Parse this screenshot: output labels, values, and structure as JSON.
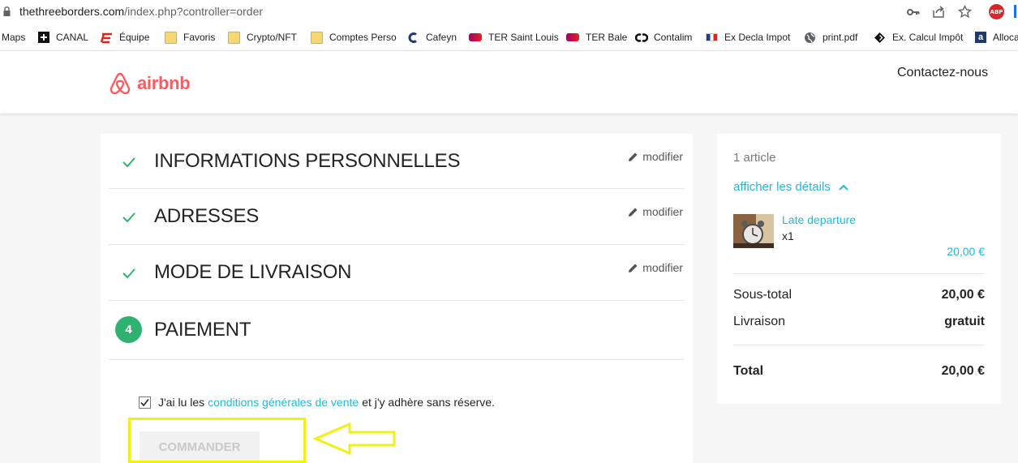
{
  "browser": {
    "url_domain": "thethreeborders.com",
    "url_path": "/index.php?controller=order",
    "abp_label": "ABP"
  },
  "bookmarks": [
    {
      "label": "Maps",
      "icon": "none"
    },
    {
      "label": "CANAL",
      "icon": "canal-plus-icon"
    },
    {
      "label": "Équipe",
      "icon": "lequipe-icon"
    },
    {
      "label": "Favoris",
      "icon": "folder-icon"
    },
    {
      "label": "Crypto/NFT",
      "icon": "folder-icon"
    },
    {
      "label": "Comptes Perso",
      "icon": "folder-icon"
    },
    {
      "label": "Cafeyn",
      "icon": "cafeyn-icon"
    },
    {
      "label": "TER Saint Louis",
      "icon": "sncf-icon"
    },
    {
      "label": "TER Bale",
      "icon": "sncf-icon"
    },
    {
      "label": "Contalim",
      "icon": "contalim-icon"
    },
    {
      "label": "Ex Decla Impot",
      "icon": "french-flag-icon"
    },
    {
      "label": "print.pdf",
      "icon": "globe-icon"
    },
    {
      "label": "Ex. Calcul Impôt",
      "icon": "diamond-icon"
    },
    {
      "label": "Alloca",
      "icon": "a-letter-icon"
    }
  ],
  "header": {
    "logo_text": "airbnb",
    "contact_label": "Contactez-nous",
    "brand_color": "#ff5a5f"
  },
  "steps": [
    {
      "title": "INFORMATIONS PERSONNELLES",
      "edit_label": "modifier",
      "status": "done"
    },
    {
      "title": "ADRESSES",
      "edit_label": "modifier",
      "status": "done"
    },
    {
      "title": "MODE DE LIVRAISON",
      "edit_label": "modifier",
      "status": "done"
    },
    {
      "title": "PAIEMENT",
      "number": "4",
      "status": "current"
    }
  ],
  "terms": {
    "prefix": "J'ai lu les",
    "link": "conditions générales de vente",
    "suffix": "et j'y adhère sans réserve.",
    "checked": true
  },
  "order_button_label": "COMMANDER",
  "summary": {
    "count": "1 article",
    "details_toggle": "afficher les détails",
    "item": {
      "name": "Late departure",
      "qty": "x1",
      "price": "20,00 €"
    },
    "subtotal_label": "Sous-total",
    "subtotal_value": "20,00 €",
    "shipping_label": "Livraison",
    "shipping_value": "gratuit",
    "total_label": "Total",
    "total_value": "20,00 €"
  },
  "colors": {
    "accent_link": "#24b9d7",
    "step_check": "#2fb170",
    "annotation_yellow": "#f2f012"
  }
}
